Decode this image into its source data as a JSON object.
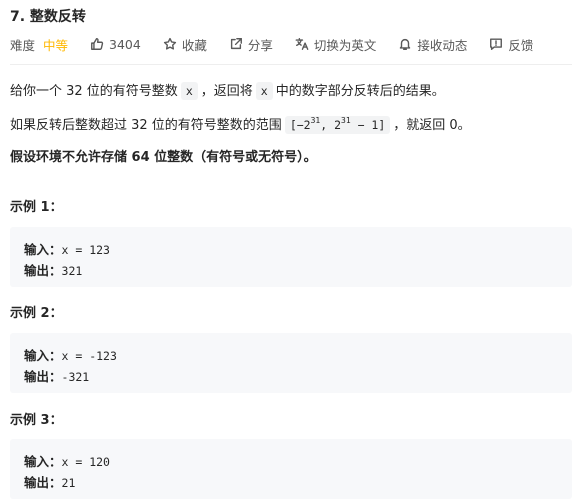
{
  "problem": {
    "title": "7. 整数反转",
    "difficulty_label": "难度",
    "difficulty_value": "中等",
    "likes": "3404",
    "favorite_label": "收藏",
    "share_label": "分享",
    "language_label": "切换为英文",
    "subscribe_label": "接收动态",
    "feedback_label": "反馈"
  },
  "description": {
    "p1_part1": "给你一个 32 位的有符号整数",
    "p1_code1": "x",
    "p1_part2": "，返回将",
    "p1_code2": "x",
    "p1_part3": "中的数字部分反转后的结果。",
    "p2_part1": "如果反转后整数超过 32 位的有符号整数的范围",
    "p2_code_open": "[−2",
    "p2_code_exp1": "31",
    "p2_code_mid": ",  2",
    "p2_code_exp2": "31",
    "p2_code_close": " − 1]",
    "p2_part2": "，就返回 0。",
    "p3": "假设环境不允许存储 64 位整数（有符号或无符号）。"
  },
  "examples": [
    {
      "title": "示例 1：",
      "input_label": "输入：",
      "input_value": "x = 123",
      "output_label": "输出：",
      "output_value": "321"
    },
    {
      "title": "示例 2：",
      "input_label": "输入：",
      "input_value": "x = -123",
      "output_label": "输出：",
      "output_value": "-321"
    },
    {
      "title": "示例 3：",
      "input_label": "输入：",
      "input_value": "x = 120",
      "output_label": "输出：",
      "output_value": "21"
    }
  ],
  "colors": {
    "difficulty_medium": "#ffb800",
    "code_background": "#f2f3f4",
    "example_background": "#f7f8fa"
  },
  "icons": [
    "thumbs-up-icon",
    "star-icon",
    "share-icon",
    "translate-icon",
    "bell-icon",
    "feedback-icon"
  ]
}
